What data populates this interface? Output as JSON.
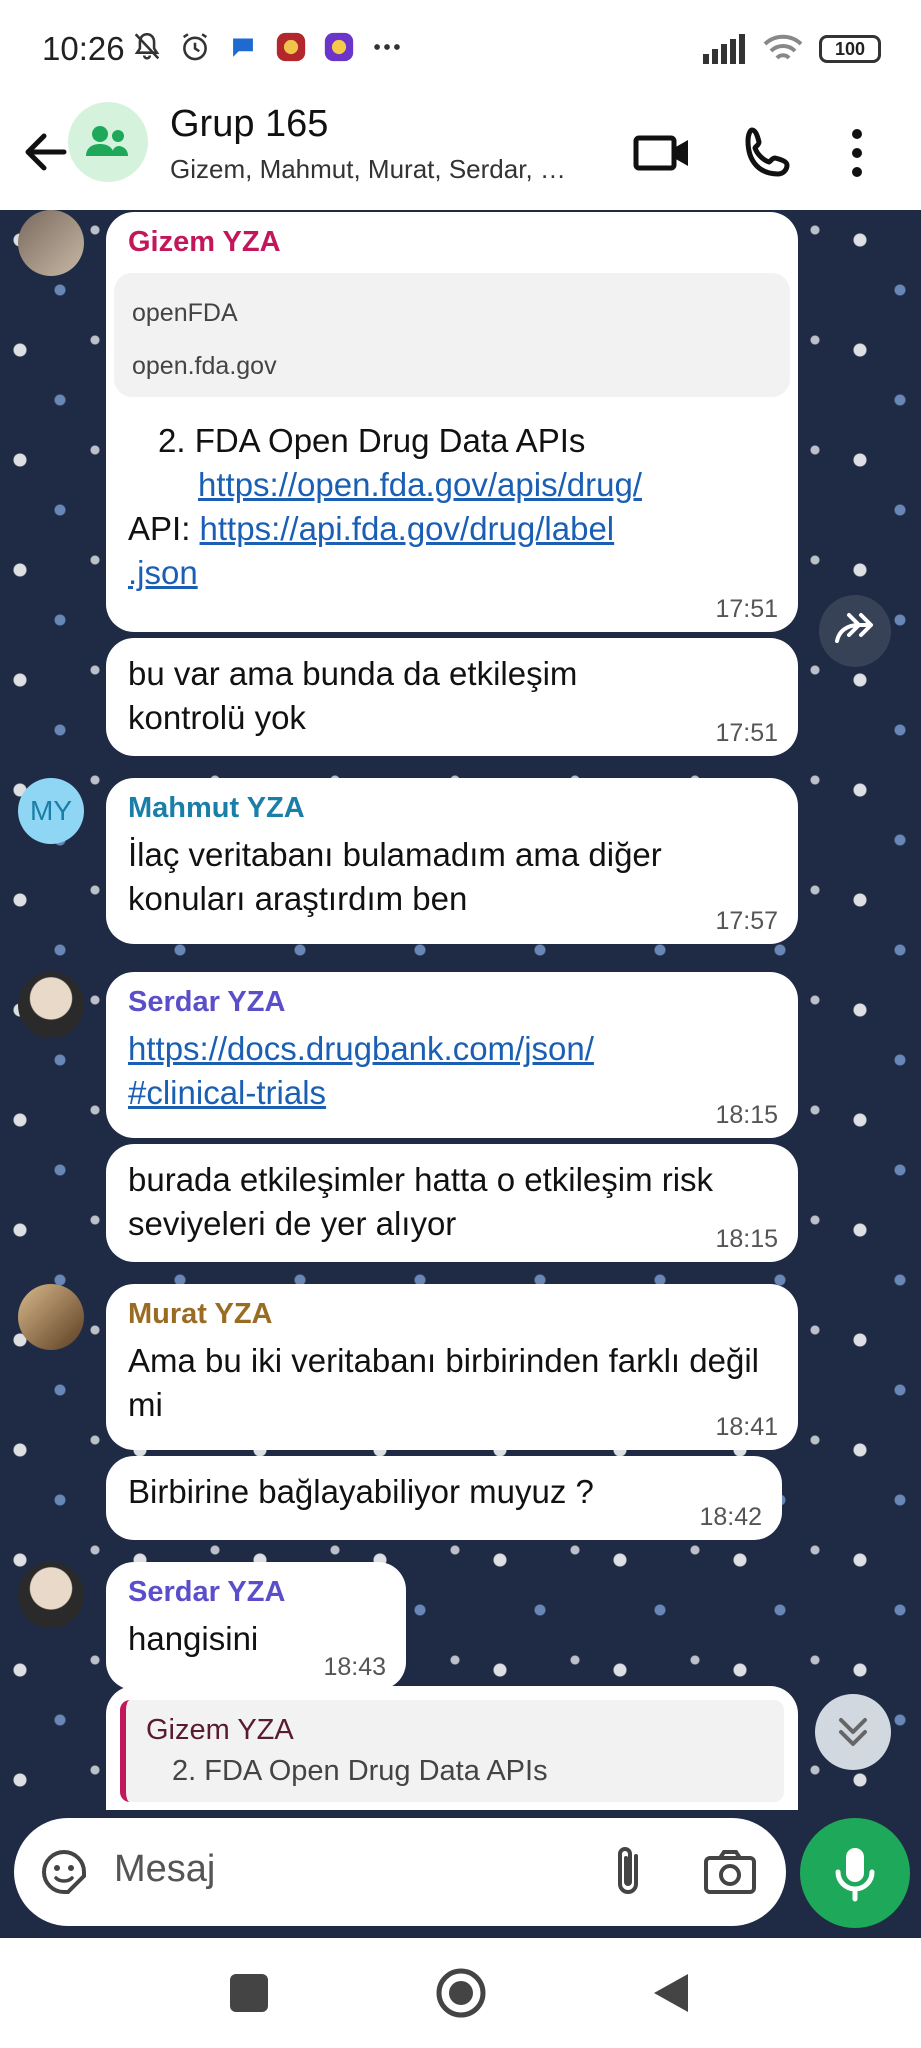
{
  "status_bar": {
    "time": "10:26",
    "battery": "100"
  },
  "header": {
    "title": "Grup 165",
    "subtitle": "Gizem, Mahmut, Murat, Serdar, …"
  },
  "messages": [
    {
      "sender": "Gizem YZA",
      "preview_title": "openFDA",
      "preview_url": "open.fda.gov",
      "line1": "2. FDA Open Drug Data APIs",
      "link1": "https://open.fda.gov/apis/drug/",
      "api_label": "API: ",
      "link2": "https://api.fda.gov/drug/label",
      "link2b": ".json",
      "time": "17:51"
    },
    {
      "text": "bu var ama bunda da etkileşim kontrolü yok",
      "time": "17:51"
    },
    {
      "sender": "Mahmut YZA",
      "avatar_initials": "MY",
      "text": "İlaç veritabanı bulamadım ama diğer konuları araştırdım ben",
      "time": "17:57"
    },
    {
      "sender": "Serdar YZA",
      "link": "https://docs.drugbank.com/json/",
      "link_b": "#clinical-trials",
      "time": "18:15"
    },
    {
      "text": "burada etkileşimler hatta o etkileşim risk seviyeleri de yer alıyor",
      "time": "18:15"
    },
    {
      "sender": "Murat YZA",
      "text": "Ama bu iki veritabanı birbirinden farklı değil mi",
      "time": "18:41"
    },
    {
      "text": "Birbirine bağlayabiliyor muyuz ?",
      "time": "18:42"
    },
    {
      "sender": "Serdar YZA",
      "text": "hangisini",
      "time": "18:43"
    },
    {
      "quote_sender": "Gizem YZA",
      "quote_text": "2. FDA Open Drug Data APIs"
    }
  ],
  "input": {
    "placeholder": "Mesaj"
  },
  "colors": {
    "gizem": "#c2185b",
    "mahmut": "#1a7fa8",
    "serdar": "#5b4fc9",
    "murat": "#9a6b22",
    "mic": "#1ea859",
    "link": "#1a5fb4"
  }
}
